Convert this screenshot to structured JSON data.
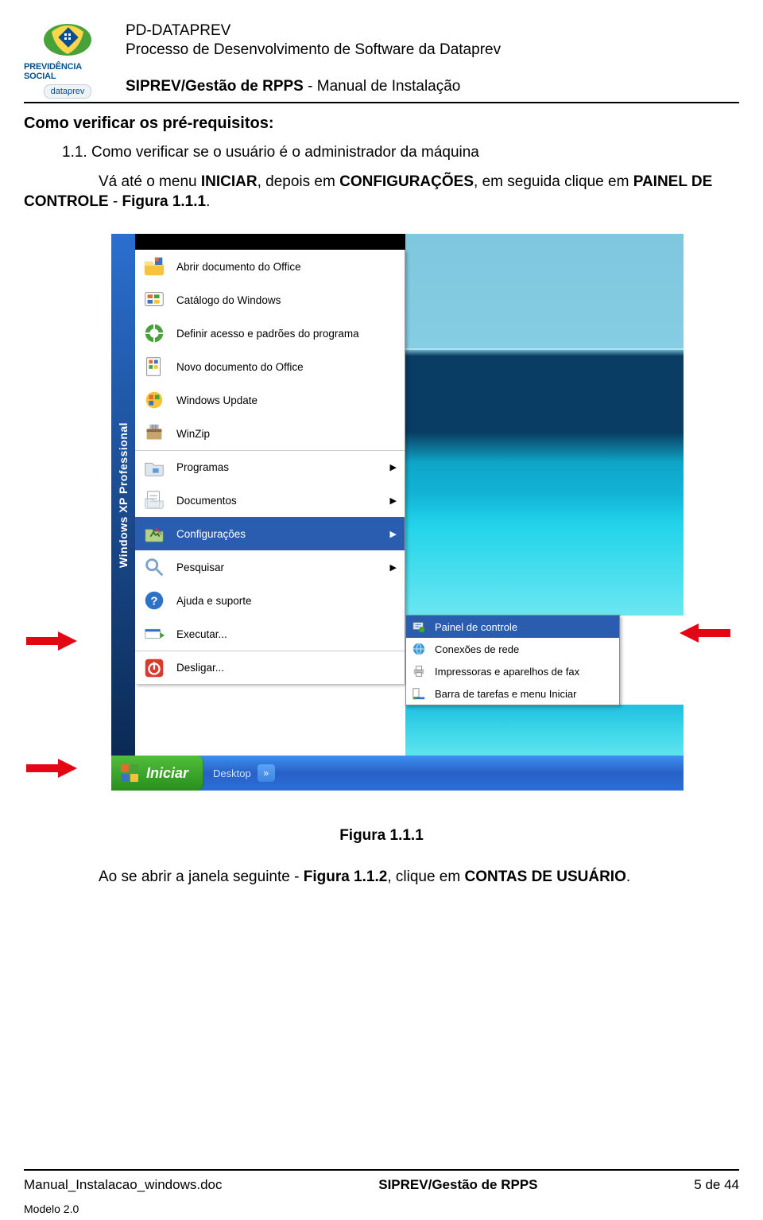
{
  "header": {
    "logo_line1": "PREVIDÊNCIA SOCIAL",
    "logo_line2": "dataprev",
    "line1": "PD-DATAPREV",
    "line2": "Processo de Desenvolvimento de Software da Dataprev",
    "line3_bold": "SIPREV/Gestão de RPPS",
    "line3_rest": " - Manual de Instalação"
  },
  "section_title": "Como verificar os pré-requisitos:",
  "step_number": "1.1.  Como verificar se o usuário é o administrador da máquina",
  "paragraph_intro_part1": "Vá até o menu ",
  "paragraph_intro_b1": "INICIAR",
  "paragraph_intro_part2": ", depois em ",
  "paragraph_intro_b2": "CONFIGURAÇÕES",
  "paragraph_intro_part3": ", em seguida clique em ",
  "paragraph_intro_b3": "PAINEL DE CONTROLE",
  "paragraph_intro_part4": " - ",
  "paragraph_intro_b4": "Figura 1.1.1",
  "paragraph_intro_part5": ".",
  "os_sidebar": "Windows XP  Professional",
  "menu": {
    "items": [
      {
        "label": "Abrir documento do Office"
      },
      {
        "label": "Catálogo do Windows"
      },
      {
        "label": "Definir acesso e padrões do programa"
      },
      {
        "label": "Novo documento do Office"
      },
      {
        "label": "Windows Update"
      },
      {
        "label": "WinZip"
      },
      {
        "label": "Programas",
        "submenu": true
      },
      {
        "label": "Documentos",
        "submenu": true
      },
      {
        "label": "Configurações",
        "submenu": true,
        "highlight": true
      },
      {
        "label": "Pesquisar",
        "submenu": true
      },
      {
        "label": "Ajuda e suporte"
      },
      {
        "label": "Executar..."
      },
      {
        "label": "Desligar..."
      }
    ]
  },
  "submenu": {
    "items": [
      {
        "label": "Painel de controle",
        "highlight": true
      },
      {
        "label": "Conexões de rede"
      },
      {
        "label": "Impressoras e aparelhos de fax"
      },
      {
        "label": "Barra de tarefas e menu Iniciar"
      }
    ]
  },
  "taskbar": {
    "start": "Iniciar",
    "desktop": "Desktop",
    "chevrons": "»"
  },
  "caption": "Figura 1.1.1",
  "after_para_part1": "Ao se abrir a janela seguinte - ",
  "after_para_b1": "Figura 1.1.2",
  "after_para_part2": ", clique em ",
  "after_para_b2": "CONTAS DE USUÁRIO",
  "after_para_part3": ".",
  "footer": {
    "left": "Manual_Instalacao_windows.doc",
    "center": "SIPREV/Gestão de RPPS",
    "right": "5 de 44",
    "modelo": "Modelo 2.0"
  }
}
